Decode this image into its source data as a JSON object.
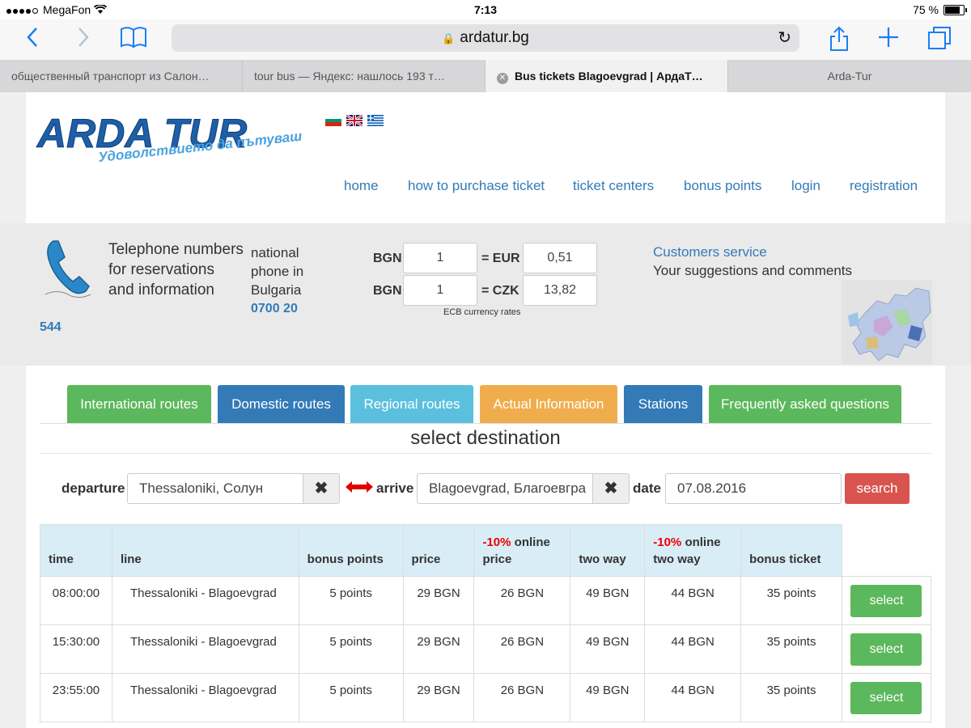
{
  "status": {
    "carrier": "MegaFon",
    "time": "7:13",
    "battery": "75 %",
    "battery_level": 0.75
  },
  "browser": {
    "url": "ardatur.bg",
    "tabs": [
      {
        "label": "общественный транспорт из Салон…",
        "active": false
      },
      {
        "label": "tour bus — Яндекс: нашлось 193 т…",
        "active": false
      },
      {
        "label": "Bus tickets Blagoevgrad | АрдаТ…",
        "active": true
      },
      {
        "label": "Arda-Tur",
        "active": false
      }
    ]
  },
  "header": {
    "logo_text": "ARDA TUR",
    "logo_slogan": "Удоволствието да пътуваш!",
    "nav": [
      "home",
      "how to purchase ticket",
      "ticket centers",
      "bonus points",
      "login",
      "registration"
    ]
  },
  "info": {
    "title_lines": [
      "Telephone numbers",
      "for reservations",
      "and information"
    ],
    "national_lines": [
      "national",
      "phone in",
      "Bulgaria"
    ],
    "phone_main": "0700 20",
    "phone_suffix": "544",
    "currency": {
      "row1": {
        "from": "BGN",
        "amount": "1",
        "to": "= EUR",
        "result": "0,51"
      },
      "row2": {
        "from": "BGN",
        "amount": "1",
        "to": "= CZK",
        "result": "13,82"
      },
      "note": "ECB currency rates"
    },
    "customer_service": "Customers service",
    "customer_sub": "Your suggestions and comments"
  },
  "route_tabs": [
    {
      "label": "International routes",
      "color": "#5cb85c"
    },
    {
      "label": "Domestic routes",
      "color": "#337ab7"
    },
    {
      "label": "Regional routes",
      "color": "#5bc0de"
    },
    {
      "label": "Actual Information",
      "color": "#f0ad4e"
    },
    {
      "label": "Stations",
      "color": "#337ab7"
    },
    {
      "label": "Frequently asked questions",
      "color": "#5cb85c"
    }
  ],
  "form": {
    "title": "select destination",
    "departure_label": "departure",
    "departure_value": "Thessaloniki, Солун",
    "arrive_label": "arrive",
    "arrive_value": "Blagoevgrad, Благоевгра",
    "date_label": "date",
    "date_value": "07.08.2016",
    "search_label": "search"
  },
  "table": {
    "headers": {
      "time": "time",
      "line": "line",
      "bonus": "bonus points",
      "price": "price",
      "online_discount": "-10%",
      "online_word": "online",
      "online_price": "price",
      "two_way": "two way",
      "online_two_way": "two way",
      "bonus_ticket": "bonus ticket"
    },
    "rows": [
      {
        "time": "08:00:00",
        "line": "Thessaloniki - Blagoevgrad",
        "bonus": "5 points",
        "price": "29 BGN",
        "online_price": "26 BGN",
        "two_way": "49 BGN",
        "online_two_way": "44 BGN",
        "bonus_ticket": "35 points",
        "action": "select"
      },
      {
        "time": "15:30:00",
        "line": "Thessaloniki - Blagoevgrad",
        "bonus": "5 points",
        "price": "29 BGN",
        "online_price": "26 BGN",
        "two_way": "49 BGN",
        "online_two_way": "44 BGN",
        "bonus_ticket": "35 points",
        "action": "select"
      },
      {
        "time": "23:55:00",
        "line": "Thessaloniki - Blagoevgrad",
        "bonus": "5 points",
        "price": "29 BGN",
        "online_price": "26 BGN",
        "two_way": "49 BGN",
        "online_two_way": "44 BGN",
        "bonus_ticket": "35 points",
        "action": "select"
      }
    ]
  }
}
